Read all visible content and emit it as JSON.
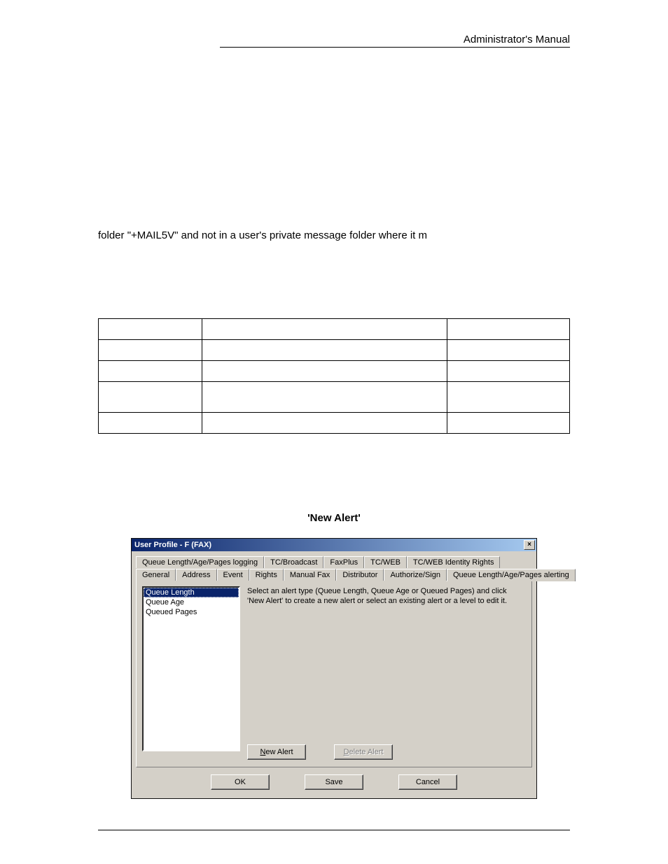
{
  "page": {
    "header_title": "Administrator's Manual",
    "body_line": "folder \"+MAIL5V\" and not in a user's private message folder where it m",
    "caption": "'New Alert'"
  },
  "dialog": {
    "title": "User Profile - F (FAX)",
    "tabs_row1": [
      "Queue Length/Age/Pages logging",
      "TC/Broadcast",
      "FaxPlus",
      "TC/WEB",
      "TC/WEB Identity Rights"
    ],
    "tabs_row2": [
      "General",
      "Address",
      "Event",
      "Rights",
      "Manual Fax",
      "Distributor",
      "Authorize/Sign",
      "Queue Length/Age/Pages alerting"
    ],
    "active_tab": "Queue Length/Age/Pages alerting",
    "list_items": [
      "Queue Length",
      "Queue Age",
      "Queued Pages"
    ],
    "list_selected": "Queue Length",
    "hint": "Select an alert type (Queue Length, Queue Age or Queued Pages) and click 'New Alert' to create a new alert or select an existing alert or a level to edit it.",
    "buttons": {
      "new_alert": "New Alert",
      "delete_alert": "Delete Alert",
      "ok": "OK",
      "save": "Save",
      "cancel": "Cancel"
    }
  }
}
